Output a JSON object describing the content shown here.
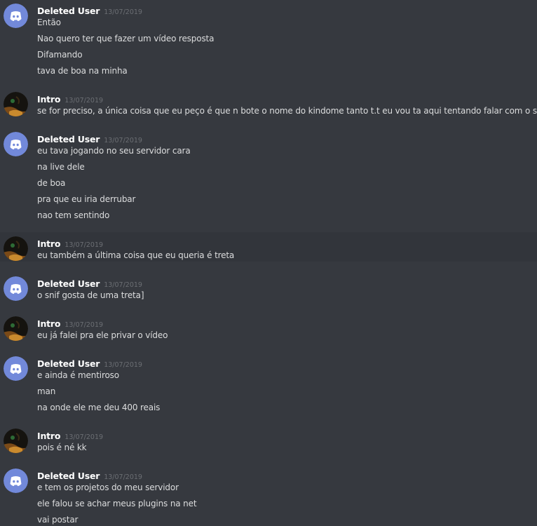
{
  "messages": [
    {
      "author": "Deleted User",
      "avatar": "discord-logo-avatar",
      "timestamp": "13/07/2019",
      "lines": [
        "Então",
        "Nao quero ter que fazer um vídeo resposta",
        "Difamando",
        "tava de boa na minha"
      ]
    },
    {
      "author": "Intro",
      "avatar": "intro-avatar",
      "timestamp": "13/07/2019",
      "lines": [
        "se for preciso, a única coisa que eu peço é que n bote o nome do kindome tanto t.t eu vou ta aqui tentando falar com o snif"
      ]
    },
    {
      "author": "Deleted User",
      "avatar": "discord-logo-avatar",
      "timestamp": "13/07/2019",
      "lines": [
        "eu tava jogando no seu servidor cara",
        "na live dele",
        "de boa",
        "pra que eu iria derrubar",
        "nao tem sentindo"
      ]
    },
    {
      "author": "Intro",
      "avatar": "intro-avatar",
      "timestamp": "13/07/2019",
      "lines": [
        "eu também a última coisa que eu queria é treta"
      ]
    },
    {
      "author": "Deleted User",
      "avatar": "discord-logo-avatar",
      "timestamp": "13/07/2019",
      "lines": [
        "o snif gosta de uma treta]"
      ]
    },
    {
      "author": "Intro",
      "avatar": "intro-avatar",
      "timestamp": "13/07/2019",
      "lines": [
        "eu já falei pra ele privar o vídeo"
      ]
    },
    {
      "author": "Deleted User",
      "avatar": "discord-logo-avatar",
      "timestamp": "13/07/2019",
      "lines": [
        "e ainda é mentiroso",
        "man",
        "na onde ele me deu 400 reais"
      ]
    },
    {
      "author": "Intro",
      "avatar": "intro-avatar",
      "timestamp": "13/07/2019",
      "lines": [
        "pois é né kk"
      ]
    },
    {
      "author": "Deleted User",
      "avatar": "discord-logo-avatar",
      "timestamp": "13/07/2019",
      "lines": [
        "e tem os projetos do meu servidor",
        "ele falou se achar meus plugins na net",
        "vai postar"
      ]
    }
  ],
  "colors": {
    "background": "#36393f",
    "deleted_user_avatar": "#7289da",
    "username": "#ffffff",
    "message_text": "#dcddde",
    "timestamp": "#6b6e73"
  }
}
